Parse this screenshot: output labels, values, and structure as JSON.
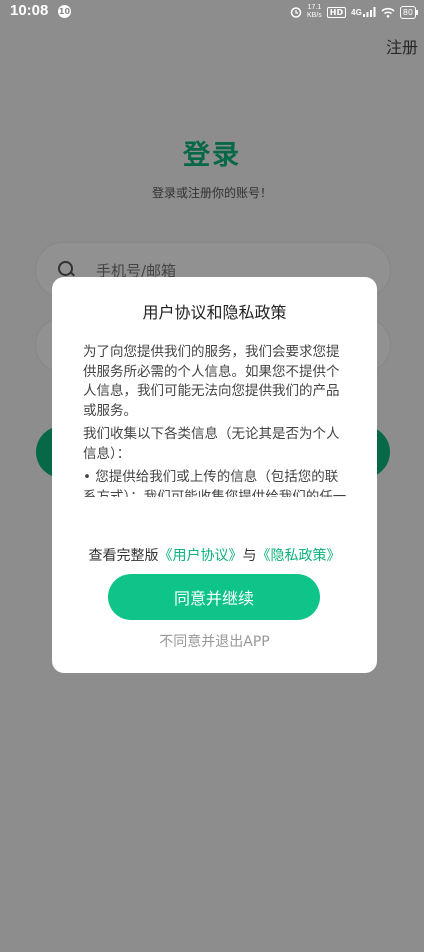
{
  "status_bar": {
    "time": "10:08",
    "notification_badge": "10",
    "net_speed": "17.1\nKB/s",
    "hd": "HD",
    "signal": "4G",
    "battery": "80"
  },
  "login": {
    "register_link": "注册",
    "title": "登录",
    "subtitle": "登录或注册你的账号！",
    "phone_placeholder": "手机号/邮箱",
    "accent_color": "#0bb37b"
  },
  "dialog": {
    "title": "用户协议和隐私政策",
    "paragraphs": [
      "为了向您提供我们的服务，我们会要求您提供服务所必需的个人信息。如果您不提供个人信息，我们可能无法向您提供我们的产品或服务。",
      "我们收集以下各类信息（无论其是否为个人信息）：",
      "• 您提供给我们或上传的信息（包括您的联系方式）：我们可能收集您提供给我们的任一或所有个人信息"
    ],
    "links_prefix": "查看完整版",
    "user_agreement_link": "《用户协议》",
    "links_conjunction": "与",
    "privacy_policy_link": "《隐私政策》",
    "agree_button": "同意并继续",
    "decline_link": "不同意并退出APP"
  }
}
